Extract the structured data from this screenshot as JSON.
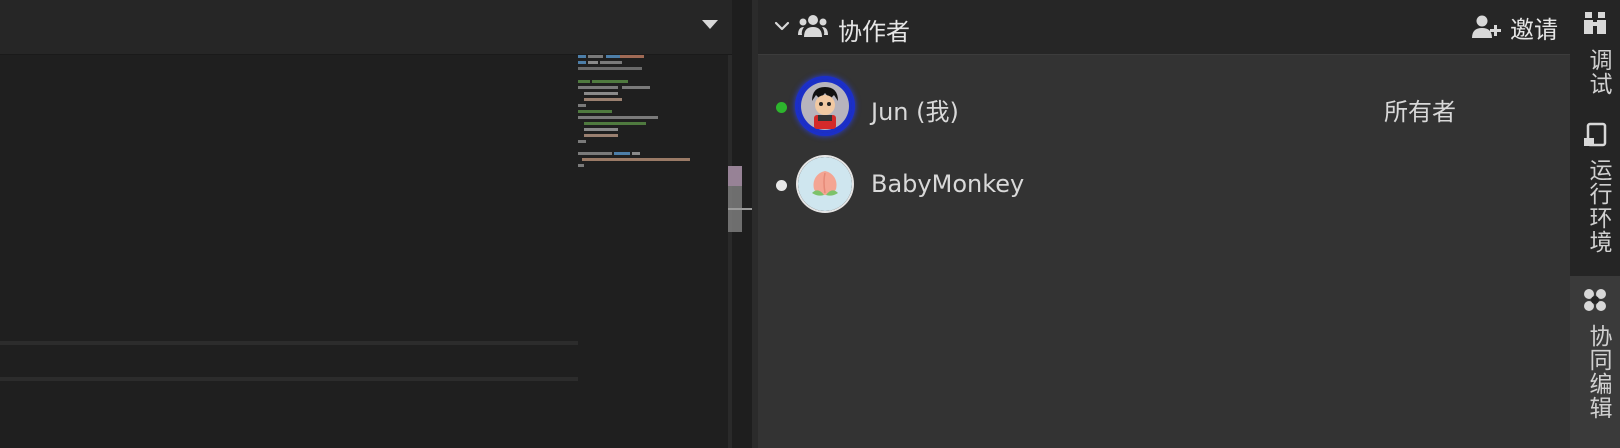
{
  "collaborators_panel": {
    "title": "协作者",
    "invite_label": "邀请",
    "members": [
      {
        "name": "Jun (我)",
        "role": "所有者",
        "status_color": "#2db52d"
      },
      {
        "name": "BabyMonkey",
        "role": "",
        "status_color": "#e8e8e8"
      }
    ]
  },
  "side_rail": {
    "items": [
      {
        "icon": "debug-icon",
        "label": "调试"
      },
      {
        "icon": "runtime-icon",
        "label": "运行环境"
      },
      {
        "icon": "collab-icon",
        "label": "协同编辑",
        "active": true
      }
    ]
  },
  "editor": {
    "tab_dropdown_icon": "caret-down-icon"
  }
}
